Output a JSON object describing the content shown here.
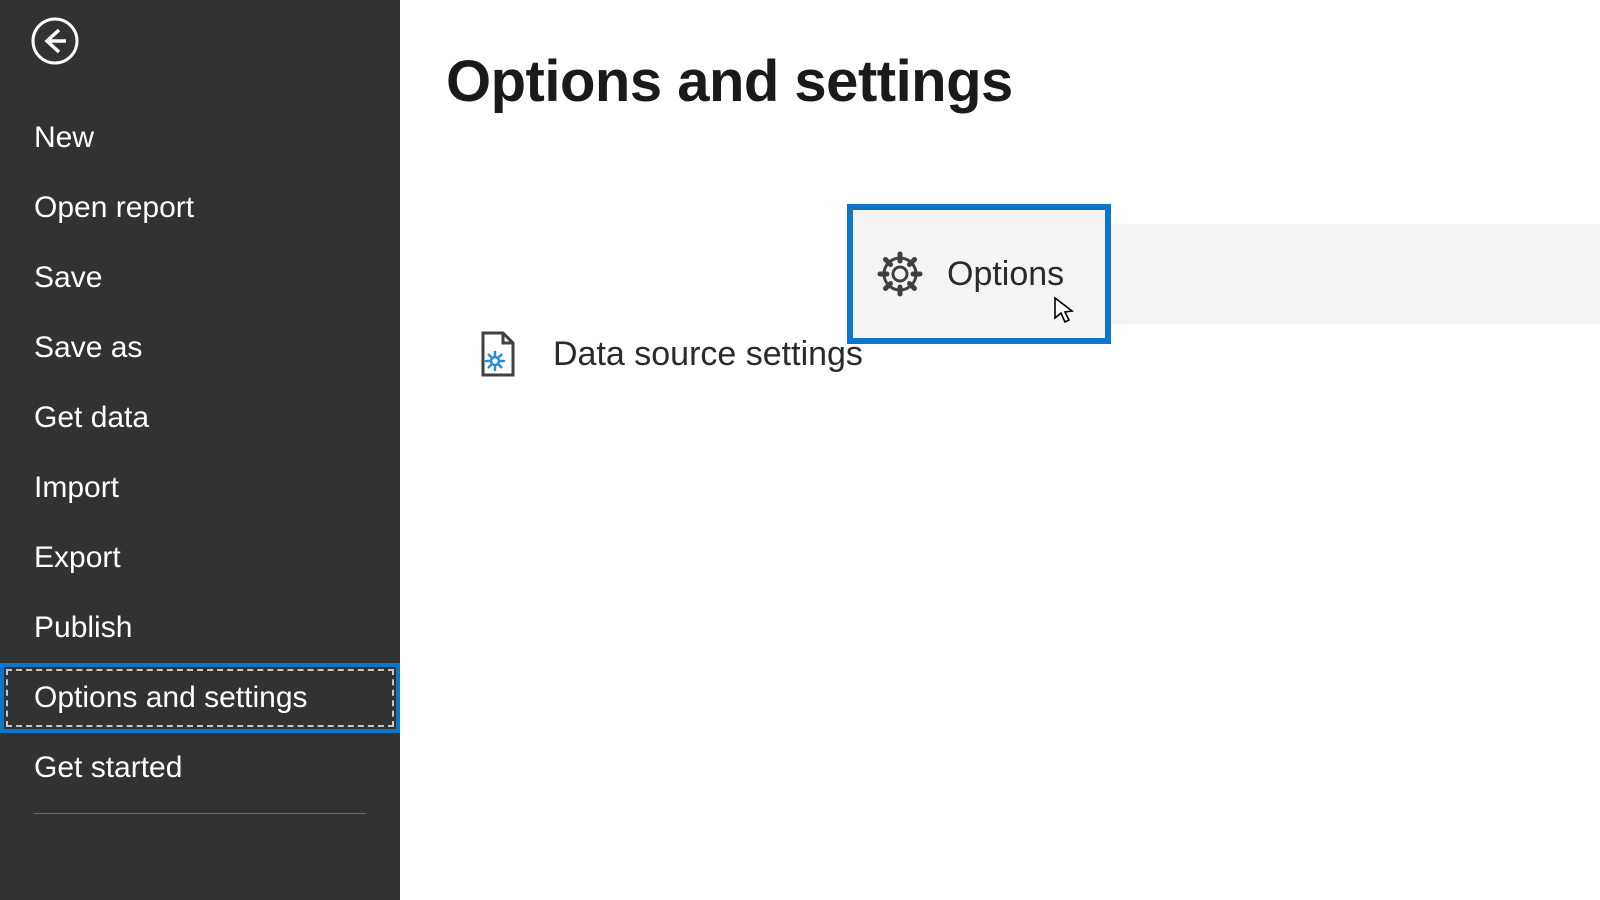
{
  "sidebar": {
    "items": [
      {
        "label": "New"
      },
      {
        "label": "Open report"
      },
      {
        "label": "Save"
      },
      {
        "label": "Save as"
      },
      {
        "label": "Get data"
      },
      {
        "label": "Import"
      },
      {
        "label": "Export"
      },
      {
        "label": "Publish"
      },
      {
        "label": "Options and settings"
      },
      {
        "label": "Get started"
      }
    ]
  },
  "content": {
    "title": "Options and settings",
    "options": [
      {
        "label": "Options"
      },
      {
        "label": "Data source settings"
      }
    ]
  }
}
